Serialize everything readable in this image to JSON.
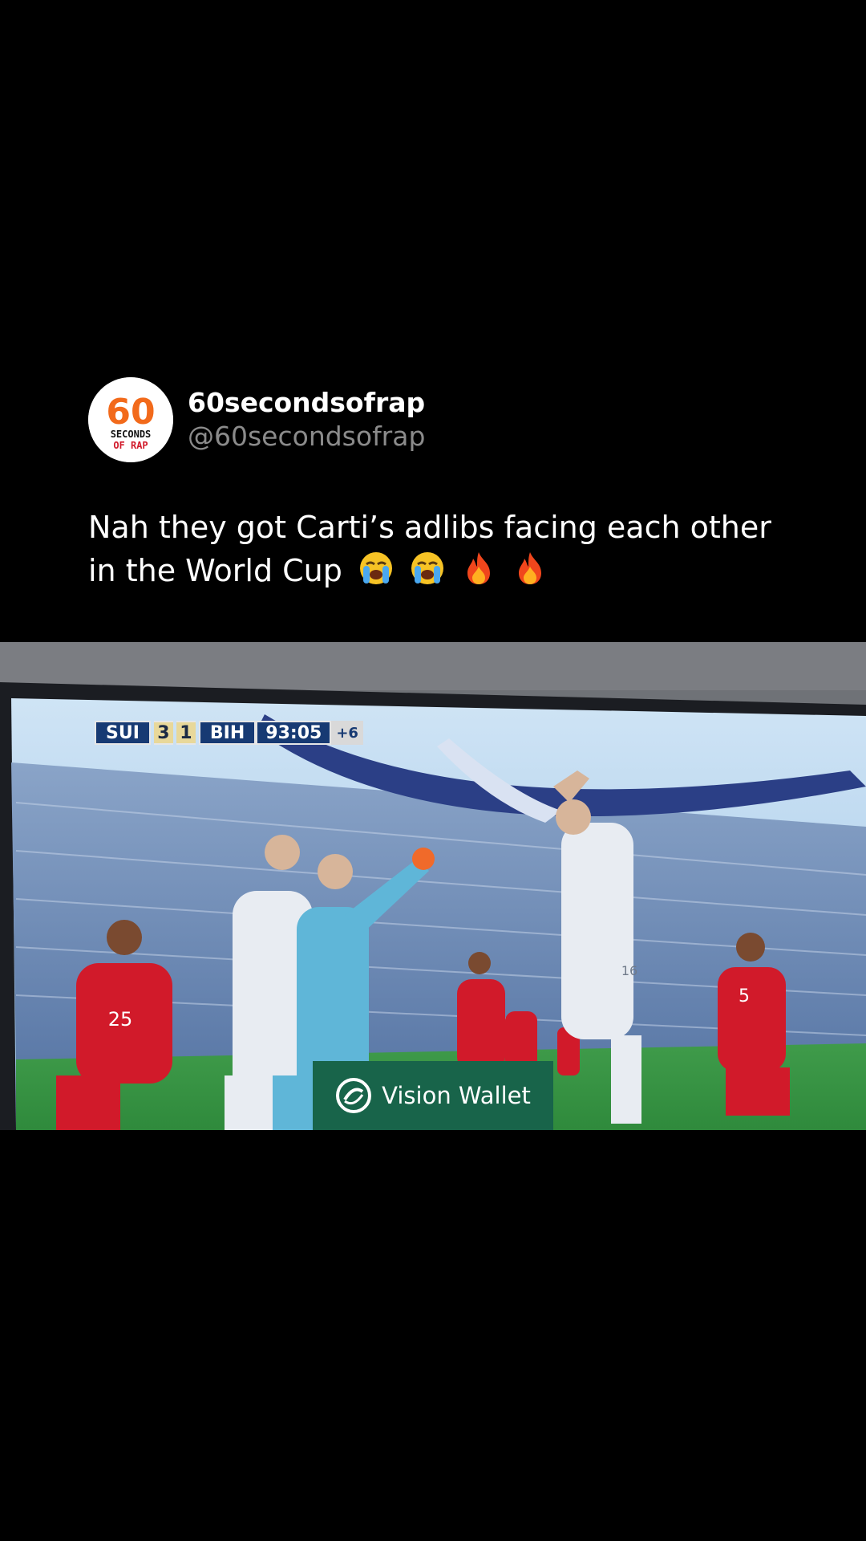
{
  "post": {
    "author": {
      "display_name": "60secondsofrap",
      "handle": "@60secondsofrap",
      "avatar_text_top": "60",
      "avatar_text_mid": "SECONDS",
      "avatar_text_bottom": "OF RAP"
    },
    "text": "Nah they got Carti’s adlibs facing each other in the World Cup",
    "emojis": [
      "loudly-crying-face",
      "loudly-crying-face",
      "fire",
      "fire"
    ]
  },
  "video": {
    "scoreboard": {
      "home_team": "SUI",
      "home_score": "3",
      "away_score": "1",
      "away_team": "BIH",
      "clock": "93:05",
      "added_time": "+6"
    },
    "sponsor_label": "Vision Wallet",
    "player_numbers": [
      "25",
      "5",
      "16"
    ]
  },
  "colors": {
    "background": "#000000",
    "handle_gray": "#8b8b8b",
    "avatar_orange": "#f26a1b",
    "scoreboard_blue": "#173a73",
    "sponsor_green": "#18644a",
    "swiss_red": "#d11a2a"
  }
}
